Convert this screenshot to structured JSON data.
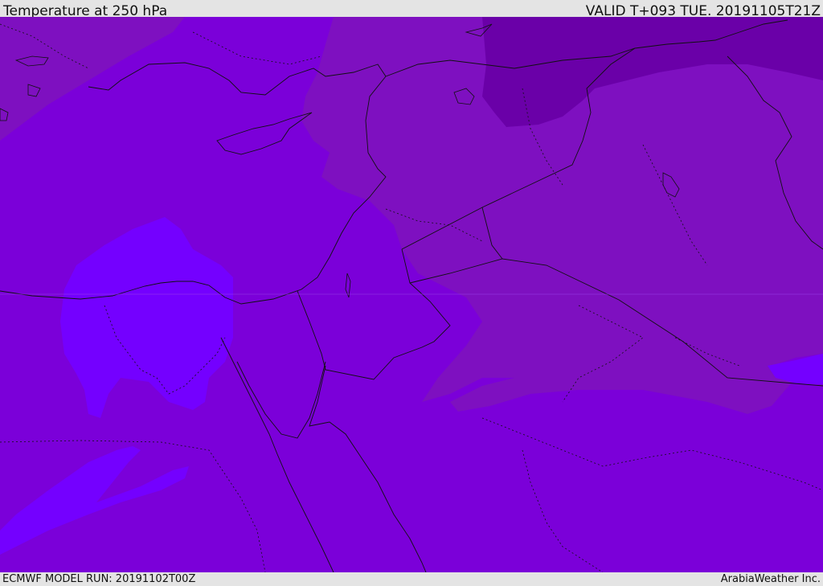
{
  "header": {
    "title": "Temperature at 250 hPa",
    "valid_time": "VALID T+093 TUE. 20191105T21Z"
  },
  "footer": {
    "model_run": "ECMWF MODEL RUN: 20191102T00Z",
    "credit": "ArabiaWeather Inc."
  },
  "colors": {
    "base_fill": "#7b00d9",
    "warm_band": "#7e10c0",
    "cold_core": "#6a00a8",
    "light_patch": "#7400ff",
    "boundaries": "#111111"
  }
}
